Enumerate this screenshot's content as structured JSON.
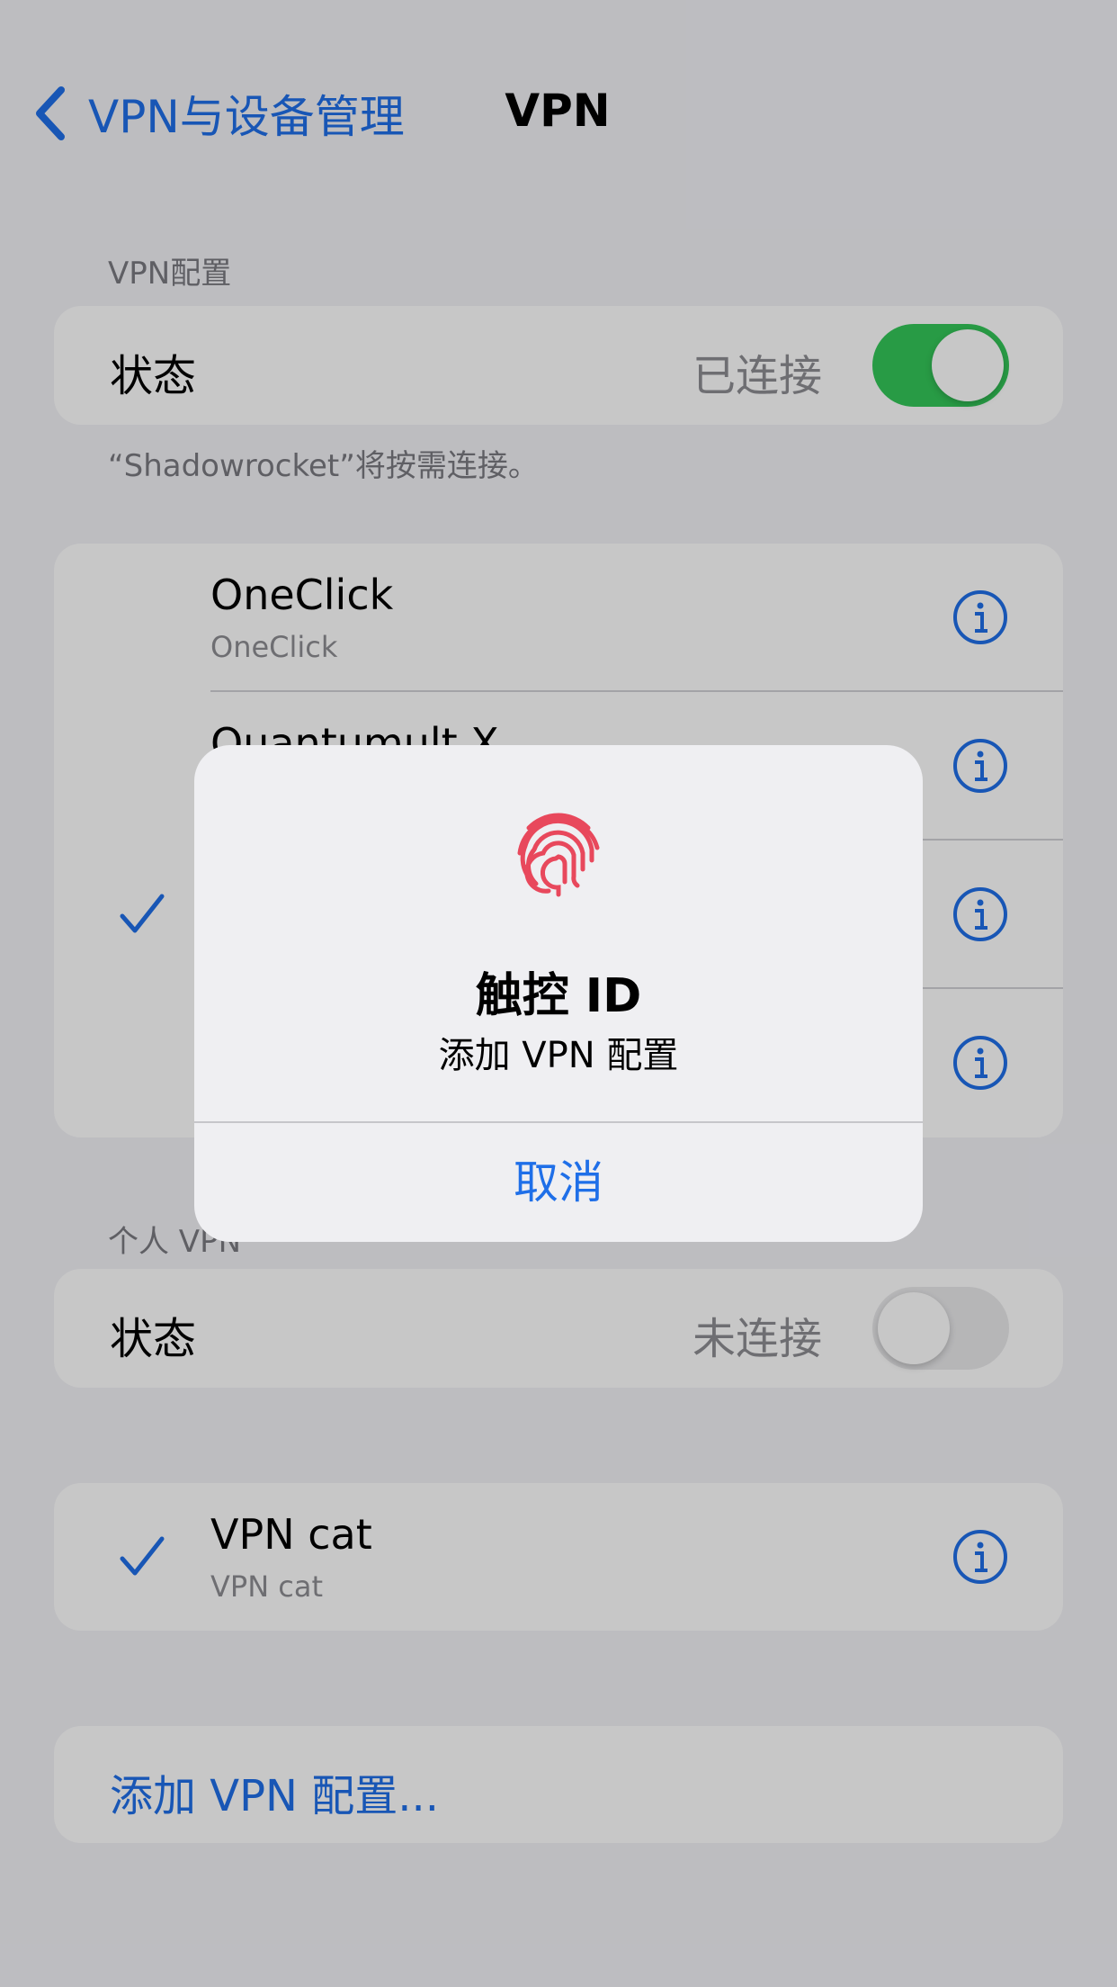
{
  "nav": {
    "back_label": "VPN与设备管理",
    "title": "VPN"
  },
  "vpn_config": {
    "header": "VPN配置",
    "status_label": "状态",
    "status_value": "已连接",
    "toggle_on": true,
    "footer": "“Shadowrocket”将按需连接。"
  },
  "profiles": [
    {
      "name": "OneClick",
      "subtitle": "OneClick",
      "checked": false
    },
    {
      "name": "Quantumult X",
      "subtitle": "",
      "checked": false
    },
    {
      "name": "",
      "subtitle": "",
      "checked": true
    },
    {
      "name": "",
      "subtitle": "",
      "checked": false
    }
  ],
  "personal_vpn": {
    "header": "个人 VPN",
    "status_label": "状态",
    "status_value": "未连接",
    "toggle_on": false
  },
  "personal_profiles": [
    {
      "name": "VPN cat",
      "subtitle": "VPN cat",
      "checked": true
    }
  ],
  "add_config_label": "添加 VPN 配置...",
  "alert": {
    "title": "触控 ID",
    "message": "添加 VPN 配置",
    "cancel_label": "取消",
    "icon": "fingerprint-icon"
  },
  "colors": {
    "accent": "#1f6fe8",
    "toggle_on": "#34c759",
    "fingerprint": "#e8485c"
  }
}
